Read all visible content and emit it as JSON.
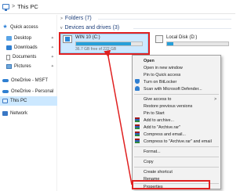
{
  "address": {
    "separator": ">",
    "crumb": "This PC"
  },
  "sidebar": {
    "items": [
      {
        "label": "Quick access",
        "icon": "star-icon"
      },
      {
        "label": "Desktop",
        "icon": "desktop-folder-icon"
      },
      {
        "label": "Downloads",
        "icon": "downloads-folder-icon"
      },
      {
        "label": "Documents",
        "icon": "documents-icon"
      },
      {
        "label": "Pictures",
        "icon": "pictures-icon"
      },
      {
        "label": "OneDrive - MSFT",
        "icon": "onedrive-icon"
      },
      {
        "label": "OneDrive - Personal",
        "icon": "onedrive-icon"
      },
      {
        "label": "This PC",
        "icon": "computer-icon"
      },
      {
        "label": "Network",
        "icon": "network-icon"
      }
    ]
  },
  "main": {
    "folders_header": "Folders (7)",
    "devices_header": "Devices and drives (3)",
    "drives": [
      {
        "name": "WIN 10 (C:)",
        "free": "36.7 GB free of 222 GB",
        "used_fraction": 0.83
      },
      {
        "name": "Local Disk (D:)",
        "free": "",
        "used_fraction": 0.1
      }
    ]
  },
  "context_menu": {
    "items": [
      "Open",
      "Open in new window",
      "Pin to Quick access",
      "Turn on BitLocker",
      "Scan with Microsoft Defender...",
      "Give access to",
      "Restore previous versions",
      "Pin to Start",
      "Add to archive...",
      "Add to \"Archive.rar\"",
      "Compress and email...",
      "Compress to \"Archive.rar\" and email",
      "Format...",
      "Copy",
      "Create shortcut",
      "Rename",
      "Properties"
    ]
  },
  "colors": {
    "highlight": "#e02020",
    "selection": "#cce8ff",
    "drive_bar": "#26a0da"
  }
}
